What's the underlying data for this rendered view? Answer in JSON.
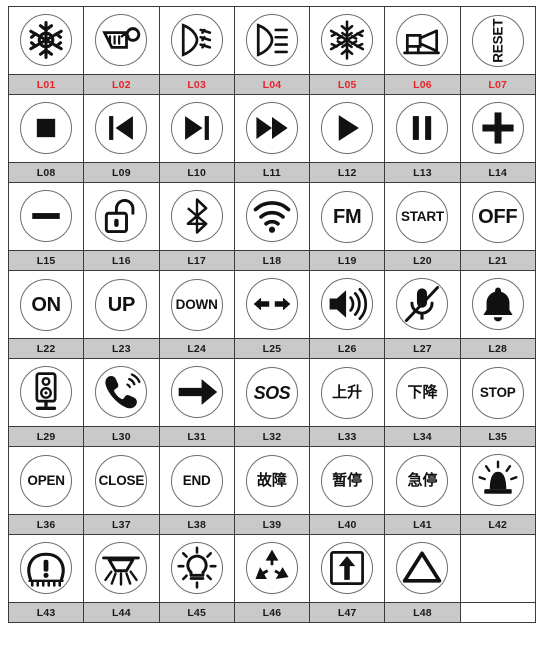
{
  "sheet": {
    "columns": 7,
    "rows": 7,
    "label_bar_color": "#c9c9c9",
    "label_color_default": "#1a1a1a",
    "label_color_row1": "#e8232a",
    "border_color": "#3b3b3b",
    "badge_stroke_color": "#6e6e6e",
    "glyph_color": "#111111"
  },
  "cells": [
    {
      "code": "L01",
      "label_color": "red",
      "icon": "snowflake-ac-icon",
      "kind": "svg"
    },
    {
      "code": "L02",
      "label_color": "red",
      "icon": "rear-defroster-icon",
      "kind": "svg"
    },
    {
      "code": "L03",
      "label_color": "red",
      "icon": "low-beam-headlight-icon",
      "kind": "svg"
    },
    {
      "code": "L04",
      "label_color": "red",
      "icon": "high-beam-headlight-icon",
      "kind": "svg"
    },
    {
      "code": "L05",
      "label_color": "red",
      "icon": "snowflake-icon",
      "kind": "svg"
    },
    {
      "code": "L06",
      "label_color": "red",
      "icon": "horn-icon",
      "kind": "svg"
    },
    {
      "code": "L07",
      "label_color": "red",
      "icon": "reset-text-icon",
      "kind": "text-rot",
      "text": "RESET",
      "size": "t-md"
    },
    {
      "code": "L08",
      "label_color": "black",
      "icon": "stop-square-icon",
      "kind": "svg"
    },
    {
      "code": "L09",
      "label_color": "black",
      "icon": "previous-track-icon",
      "kind": "svg"
    },
    {
      "code": "L10",
      "label_color": "black",
      "icon": "next-track-icon",
      "kind": "svg"
    },
    {
      "code": "L11",
      "label_color": "black",
      "icon": "fast-forward-icon",
      "kind": "svg"
    },
    {
      "code": "L12",
      "label_color": "black",
      "icon": "play-icon",
      "kind": "svg"
    },
    {
      "code": "L13",
      "label_color": "black",
      "icon": "pause-icon",
      "kind": "svg"
    },
    {
      "code": "L14",
      "label_color": "black",
      "icon": "plus-icon",
      "kind": "svg"
    },
    {
      "code": "L15",
      "label_color": "black",
      "icon": "minus-icon",
      "kind": "svg"
    },
    {
      "code": "L16",
      "label_color": "black",
      "icon": "unlock-padlock-icon",
      "kind": "svg"
    },
    {
      "code": "L17",
      "label_color": "black",
      "icon": "bluetooth-icon",
      "kind": "svg"
    },
    {
      "code": "L18",
      "label_color": "black",
      "icon": "wifi-icon",
      "kind": "svg"
    },
    {
      "code": "L19",
      "label_color": "black",
      "icon": "fm-text-icon",
      "kind": "text",
      "text": "FM",
      "size": "t-xl"
    },
    {
      "code": "L20",
      "label_color": "black",
      "icon": "start-text-icon",
      "kind": "text",
      "text": "START",
      "size": "t-md"
    },
    {
      "code": "L21",
      "label_color": "black",
      "icon": "off-text-icon",
      "kind": "text",
      "text": "OFF",
      "size": "t-xl"
    },
    {
      "code": "L22",
      "label_color": "black",
      "icon": "on-text-icon",
      "kind": "text",
      "text": "ON",
      "size": "t-xl"
    },
    {
      "code": "L23",
      "label_color": "black",
      "icon": "up-text-icon",
      "kind": "text",
      "text": "UP",
      "size": "t-xl"
    },
    {
      "code": "L24",
      "label_color": "black",
      "icon": "down-text-icon",
      "kind": "text",
      "text": "DOWN",
      "size": "t-md"
    },
    {
      "code": "L25",
      "label_color": "black",
      "icon": "left-right-arrows-icon",
      "kind": "svg"
    },
    {
      "code": "L26",
      "label_color": "black",
      "icon": "volume-up-icon",
      "kind": "svg"
    },
    {
      "code": "L27",
      "label_color": "black",
      "icon": "microphone-mute-icon",
      "kind": "svg"
    },
    {
      "code": "L28",
      "label_color": "black",
      "icon": "bell-icon",
      "kind": "svg"
    },
    {
      "code": "L29",
      "label_color": "black",
      "icon": "loudspeaker-stand-icon",
      "kind": "svg"
    },
    {
      "code": "L30",
      "label_color": "black",
      "icon": "phone-ringing-icon",
      "kind": "svg"
    },
    {
      "code": "L31",
      "label_color": "black",
      "icon": "arrow-right-icon",
      "kind": "svg"
    },
    {
      "code": "L32",
      "label_color": "black",
      "icon": "sos-text-icon",
      "kind": "text",
      "text": "SOS",
      "size": "t-sos"
    },
    {
      "code": "L33",
      "label_color": "black",
      "icon": "ascend-text-icon",
      "kind": "text",
      "text": "上升",
      "size": "t-cjk"
    },
    {
      "code": "L34",
      "label_color": "black",
      "icon": "descend-text-icon",
      "kind": "text",
      "text": "下降",
      "size": "t-cjk"
    },
    {
      "code": "L35",
      "label_color": "black",
      "icon": "stop-text-icon",
      "kind": "text",
      "text": "STOP",
      "size": "t-md"
    },
    {
      "code": "L36",
      "label_color": "black",
      "icon": "open-text-icon",
      "kind": "text",
      "text": "OPEN",
      "size": "t-md"
    },
    {
      "code": "L37",
      "label_color": "black",
      "icon": "close-text-icon",
      "kind": "text",
      "text": "CLOSE",
      "size": "t-md"
    },
    {
      "code": "L38",
      "label_color": "black",
      "icon": "end-text-icon",
      "kind": "text",
      "text": "END",
      "size": "t-md"
    },
    {
      "code": "L39",
      "label_color": "black",
      "icon": "fault-text-icon",
      "kind": "text",
      "text": "故障",
      "size": "t-cjk"
    },
    {
      "code": "L40",
      "label_color": "black",
      "icon": "pause-text-icon",
      "kind": "text",
      "text": "暂停",
      "size": "t-cjk"
    },
    {
      "code": "L41",
      "label_color": "black",
      "icon": "emergency-stop-text-icon",
      "kind": "text",
      "text": "急停",
      "size": "t-cjk"
    },
    {
      "code": "L42",
      "label_color": "black",
      "icon": "beacon-light-icon",
      "kind": "svg"
    },
    {
      "code": "L43",
      "label_color": "black",
      "icon": "tire-pressure-warning-icon",
      "kind": "svg"
    },
    {
      "code": "L44",
      "label_color": "black",
      "icon": "ceiling-downlight-icon",
      "kind": "svg"
    },
    {
      "code": "L45",
      "label_color": "black",
      "icon": "light-bulb-icon",
      "kind": "svg"
    },
    {
      "code": "L46",
      "label_color": "black",
      "icon": "recycle-icon",
      "kind": "svg"
    },
    {
      "code": "L47",
      "label_color": "black",
      "icon": "this-side-up-icon",
      "kind": "svg"
    },
    {
      "code": "L48",
      "label_color": "black",
      "icon": "warning-triangle-icon",
      "kind": "svg"
    },
    {
      "code": "",
      "label_color": "black",
      "icon": "empty-icon",
      "kind": "empty"
    }
  ]
}
